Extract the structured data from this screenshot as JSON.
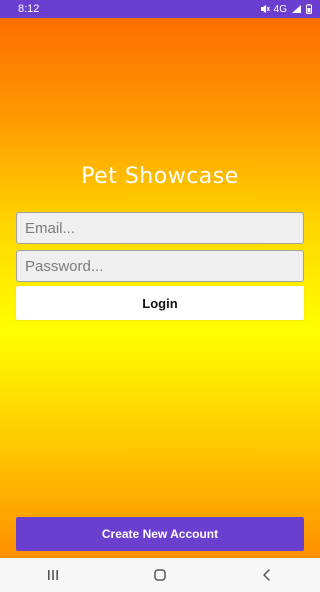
{
  "status_bar": {
    "time": "8:12",
    "network_label": "4G",
    "icons": [
      "mute-icon",
      "network-icon",
      "signal-icon",
      "battery-icon"
    ]
  },
  "app": {
    "title": "Pet Showcase"
  },
  "login_form": {
    "email_placeholder": "Email...",
    "password_placeholder": "Password...",
    "login_label": "Login"
  },
  "footer": {
    "create_account_label": "Create New Account"
  },
  "navigation_bar": {
    "icons": [
      "recent-apps-icon",
      "home-icon",
      "back-icon"
    ]
  },
  "colors": {
    "status_bar": "#6a3fd0",
    "gradient_top": "#ff6e00",
    "gradient_middle": "#ffff00",
    "gradient_bottom": "#ff8f00",
    "create_account_button": "#6a3fd0",
    "input_background": "#efefef"
  }
}
